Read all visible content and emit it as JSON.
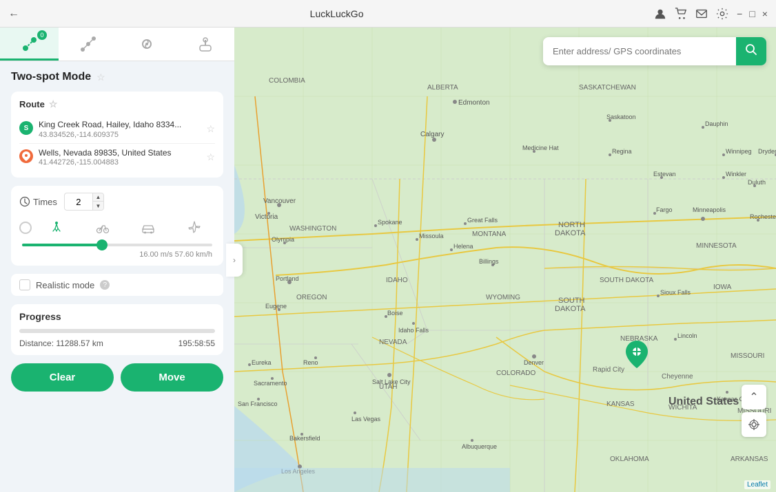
{
  "titlebar": {
    "app_name": "LuckLuckGo",
    "back_icon": "←"
  },
  "window_controls": {
    "minimize": "−",
    "maximize": "□",
    "close": "×"
  },
  "header_icons": {
    "profile": "👤",
    "cart": "🛒",
    "mail": "✉",
    "settings": "⚙"
  },
  "mode_tabs": [
    {
      "id": "two-spot",
      "label": "Two-spot Mode",
      "active": true,
      "badge": "0"
    },
    {
      "id": "multi-spot",
      "label": "Multi-spot Mode",
      "active": false
    },
    {
      "id": "jump",
      "label": "Jump Mode",
      "active": false
    },
    {
      "id": "joystick",
      "label": "Joystick Mode",
      "active": false
    }
  ],
  "panel": {
    "mode_title": "Two-spot Mode",
    "route_label": "Route",
    "start_location": {
      "name": "King Creek Road, Hailey, Idaho 8334...",
      "coords": "43.834526,-114.609375"
    },
    "end_location": {
      "name": "Wells, Nevada 89835, United States",
      "coords": "41.442726,-115.004883"
    },
    "times_label": "Times",
    "times_value": "2",
    "speed_value": "16.00 m/s  57.60 km/h",
    "realistic_mode_label": "Realistic mode",
    "progress_title": "Progress",
    "progress_distance": "Distance: 11288.57 km",
    "progress_time": "195:58:55",
    "btn_clear": "Clear",
    "btn_move": "Move"
  },
  "map_search": {
    "placeholder": "Enter address/ GPS coordinates"
  },
  "marker": {
    "lat": 484,
    "lng": 244
  }
}
